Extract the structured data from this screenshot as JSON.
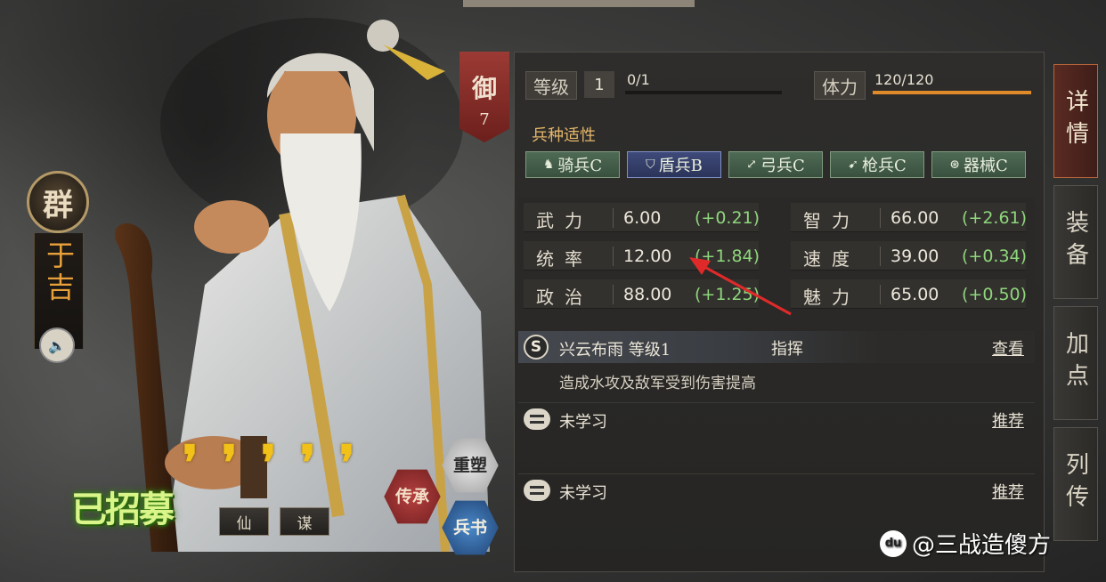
{
  "hero": {
    "faction": "群",
    "name": "于吉",
    "recruited_label": "已招募",
    "stars": [
      "❜",
      "❜",
      "❜",
      "❜",
      "❜"
    ],
    "tags": [
      "仙",
      "谋"
    ],
    "hex_buttons": {
      "chuancheng": "传承",
      "chongsu": "重塑",
      "bingshu": "兵书"
    }
  },
  "rank": {
    "label": "御",
    "value": "7"
  },
  "level": {
    "label": "等级",
    "value": "1",
    "exp": "0/1",
    "exp_fraction": 0.0
  },
  "stamina": {
    "label": "体力",
    "value": "120/120",
    "fraction": 1.0
  },
  "troops": {
    "title": "兵种适性",
    "items": [
      {
        "icon": "♞",
        "label": "骑兵C"
      },
      {
        "icon": "⛉",
        "label": "盾兵B"
      },
      {
        "icon": "⤢",
        "label": "弓兵C"
      },
      {
        "icon": "➹",
        "label": "枪兵C"
      },
      {
        "icon": "⊛",
        "label": "器械C"
      }
    ]
  },
  "attributes": [
    {
      "name": "武力",
      "value": "6.00",
      "bonus": "(+0.21)"
    },
    {
      "name": "智力",
      "value": "66.00",
      "bonus": "(+2.61)"
    },
    {
      "name": "统率",
      "value": "12.00",
      "bonus": "(+1.84)"
    },
    {
      "name": "速度",
      "value": "39.00",
      "bonus": "(+0.34)"
    },
    {
      "name": "政治",
      "value": "88.00",
      "bonus": "(+1.25)"
    },
    {
      "name": "魅力",
      "value": "65.00",
      "bonus": "(+0.50)"
    }
  ],
  "skills": [
    {
      "badge": "S",
      "name": "兴云布雨 等级1",
      "type": "指挥",
      "link": "查看",
      "desc": "造成水攻及敌军受到伤害提高"
    },
    {
      "name": "未学习",
      "link": "推荐"
    },
    {
      "name": "未学习",
      "link": "推荐"
    }
  ],
  "tabs": [
    "详情",
    "装备",
    "加点",
    "列传"
  ],
  "watermark": {
    "logo": "du",
    "text": "@三战造傻方"
  },
  "colors": {
    "accent": "#e08b2a",
    "bonus": "#8ed67c",
    "rank": "#9c3a34"
  }
}
